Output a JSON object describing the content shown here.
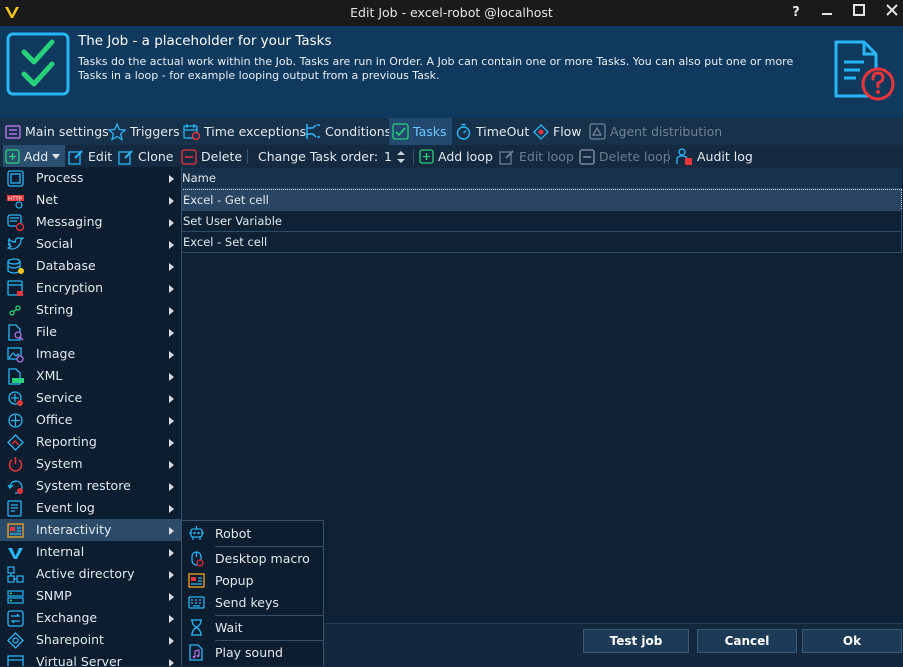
{
  "window": {
    "title": "Edit Job - excel-robot @localhost",
    "help_label": "?"
  },
  "header": {
    "title": "The Job - a placeholder for your Tasks",
    "description": "Tasks do the actual work within the Job. Tasks are run in Order. A Job can contain one or more Tasks. You can also put one or more Tasks in a loop - for example looping output from a previous Task."
  },
  "tabs": [
    {
      "label": "Main settings",
      "icon": "settings-icon",
      "state": "normal"
    },
    {
      "label": "Triggers",
      "icon": "star-icon",
      "state": "normal"
    },
    {
      "label": "Time exceptions",
      "icon": "calendar-icon",
      "state": "normal"
    },
    {
      "label": "Conditions",
      "icon": "conditions-icon",
      "state": "normal"
    },
    {
      "label": "Tasks",
      "icon": "check-icon",
      "state": "active"
    },
    {
      "label": "TimeOut",
      "icon": "stopwatch-icon",
      "state": "normal"
    },
    {
      "label": "Flow",
      "icon": "flow-icon",
      "state": "normal"
    },
    {
      "label": "Agent distribution",
      "icon": "agent-icon",
      "state": "disabled"
    }
  ],
  "toolbar": {
    "add_label": "Add",
    "edit_label": "Edit",
    "clone_label": "Clone",
    "delete_label": "Delete",
    "change_order_label": "Change Task order:",
    "order_value": "1",
    "add_loop_label": "Add loop",
    "edit_loop_label": "Edit loop",
    "delete_loop_label": "Delete loop",
    "audit_log_label": "Audit log"
  },
  "task_list": {
    "column_name": "Name",
    "rows": [
      "Excel - Get cell",
      "Set User Variable",
      "Excel - Set cell"
    ],
    "selected_index": 0
  },
  "add_menu": {
    "items": [
      {
        "label": "Process",
        "icon": "process-icon"
      },
      {
        "label": "Net",
        "icon": "http-icon"
      },
      {
        "label": "Messaging",
        "icon": "messaging-icon"
      },
      {
        "label": "Social",
        "icon": "twitter-bird-icon"
      },
      {
        "label": "Database",
        "icon": "database-icon"
      },
      {
        "label": "Encryption",
        "icon": "encryption-icon"
      },
      {
        "label": "String",
        "icon": "string-icon"
      },
      {
        "label": "File",
        "icon": "file-icon"
      },
      {
        "label": "Image",
        "icon": "image-icon"
      },
      {
        "label": "XML",
        "icon": "xml-icon"
      },
      {
        "label": "Service",
        "icon": "service-icon"
      },
      {
        "label": "Office",
        "icon": "office-icon"
      },
      {
        "label": "Reporting",
        "icon": "reporting-icon"
      },
      {
        "label": "System",
        "icon": "power-icon"
      },
      {
        "label": "System restore",
        "icon": "system-restore-icon"
      },
      {
        "label": "Event log",
        "icon": "event-log-icon"
      },
      {
        "label": "Interactivity",
        "icon": "interactivity-icon"
      },
      {
        "label": "Internal",
        "icon": "internal-icon"
      },
      {
        "label": "Active directory",
        "icon": "active-directory-icon"
      },
      {
        "label": "SNMP",
        "icon": "snmp-icon"
      },
      {
        "label": "Exchange",
        "icon": "exchange-icon"
      },
      {
        "label": "Sharepoint",
        "icon": "sharepoint-icon"
      },
      {
        "label": "Virtual Server",
        "icon": "virtual-server-icon"
      }
    ],
    "highlighted": "Interactivity"
  },
  "interactivity_submenu": {
    "items": [
      {
        "label": "Robot",
        "icon": "robot-icon"
      },
      {
        "label": "Desktop macro",
        "icon": "mouse-icon"
      },
      {
        "label": "Popup",
        "icon": "popup-icon"
      },
      {
        "label": "Send keys",
        "icon": "keyboard-icon"
      },
      {
        "label": "Wait",
        "icon": "hourglass-icon"
      },
      {
        "label": "Play sound",
        "icon": "music-file-icon"
      }
    ]
  },
  "footer": {
    "test_job_label": "Test job",
    "cancel_label": "Cancel",
    "ok_label": "Ok"
  },
  "colors": {
    "accent_cyan": "#29b6f6",
    "accent_red": "#e8353c",
    "active_tab_text": "#6cc7ff",
    "background": "#0f2235",
    "header_background": "#0f3a5e"
  }
}
